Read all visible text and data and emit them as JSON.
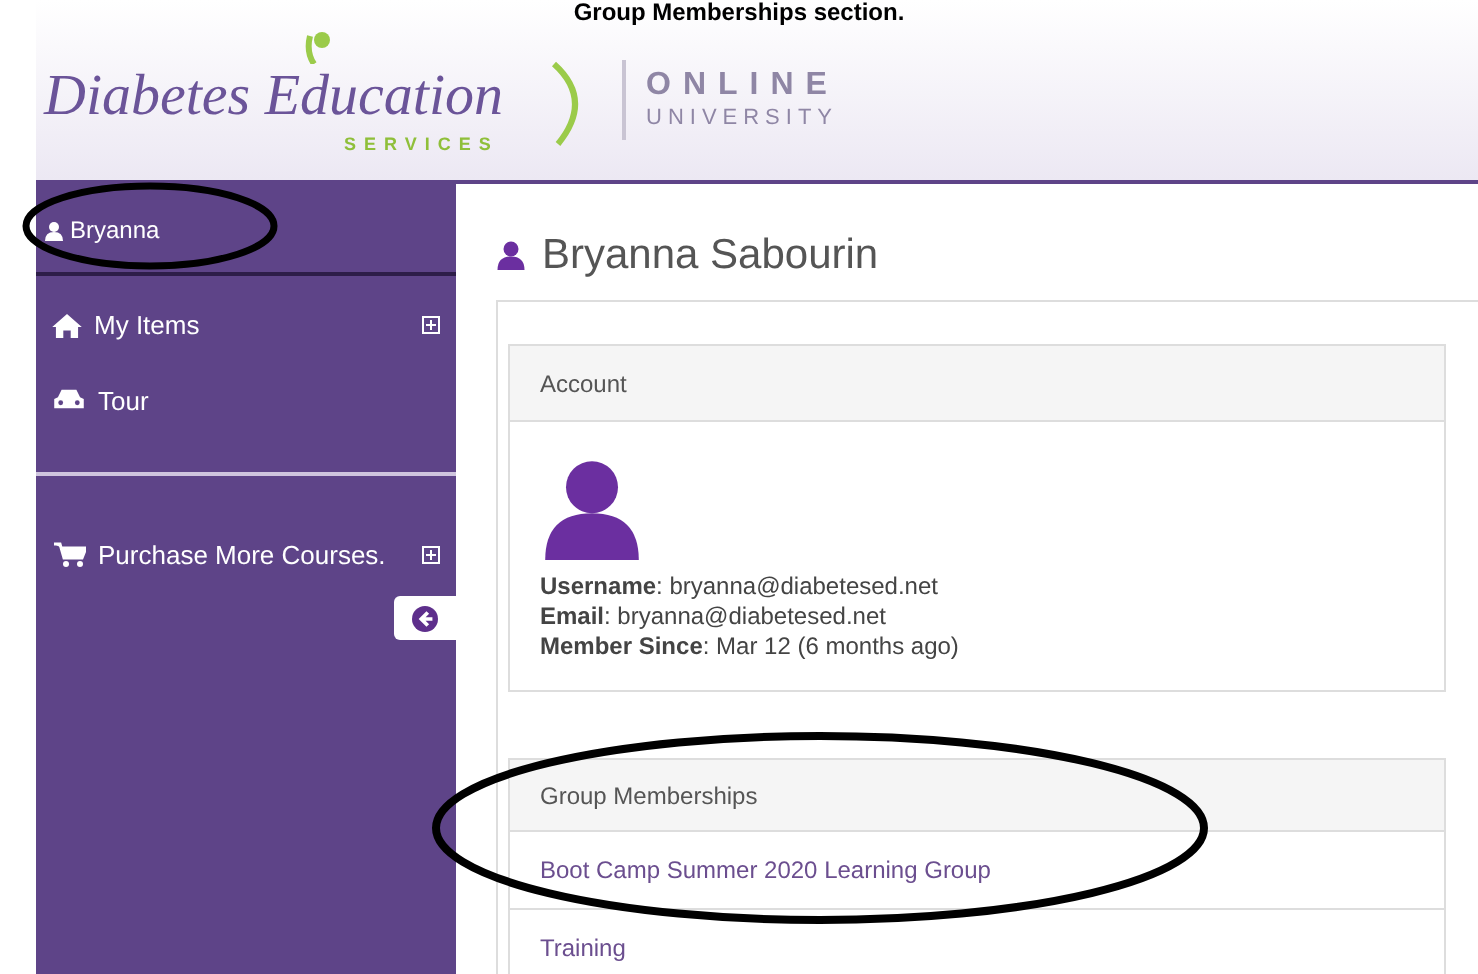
{
  "caption": "Group Memberships section.",
  "logo": {
    "name": "Diabetes Education",
    "subtitle": "SERVICES",
    "tagline_1": "ONLINE",
    "tagline_2": "UNIVERSITY"
  },
  "sidebar": {
    "user": "Bryanna",
    "items": [
      {
        "label": "My Items",
        "expandable": true
      },
      {
        "label": "Tour",
        "expandable": false
      },
      {
        "label": "Purchase More Courses.",
        "expandable": true
      }
    ]
  },
  "page_title": "Bryanna Sabourin",
  "account": {
    "heading": "Account",
    "fields": [
      {
        "label": "Username",
        "value": ": bryanna@diabetesed.net"
      },
      {
        "label": "Email",
        "value": ": bryanna@diabetesed.net"
      },
      {
        "label": "Member Since",
        "value": ": Mar 12 (6 months ago)"
      }
    ]
  },
  "groups": {
    "heading": "Group Memberships",
    "items": [
      "Boot Camp Summer 2020 Learning Group",
      "Training"
    ]
  }
}
